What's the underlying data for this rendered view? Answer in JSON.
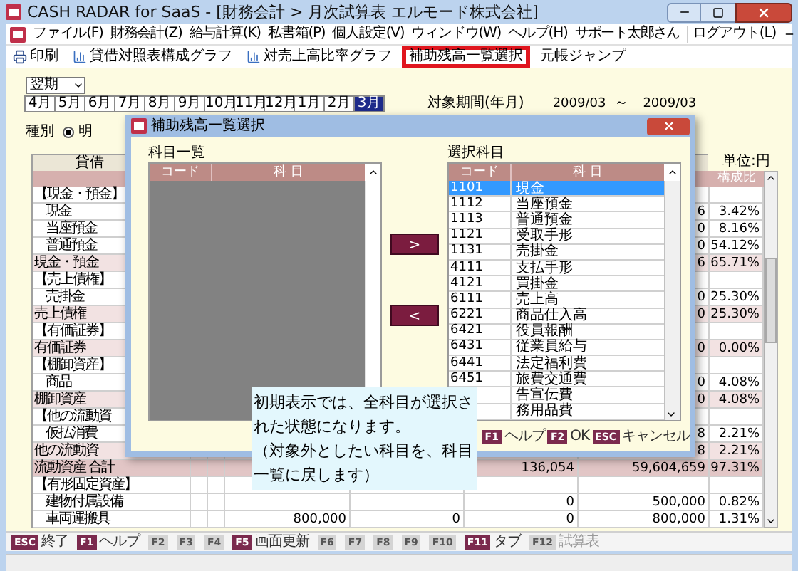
{
  "window": {
    "title": "CASH RADAR for SaaS - [財務会計 > 月次試算表 エルモード株式会社]"
  },
  "menu": {
    "items": [
      "ファイル(F)",
      "財務会計(Z)",
      "給与計算(K)",
      "私書箱(P)",
      "個人設定(V)",
      "ウィンドウ(W)",
      "ヘルプ(H)"
    ],
    "user": "サポート太郎さん",
    "logout": "ログアウト(L)"
  },
  "toolbar": [
    {
      "label": "印刷",
      "kind": "print",
      "highlighted": false
    },
    {
      "label": "貸借対照表構成グラフ",
      "kind": "chart",
      "highlighted": false
    },
    {
      "label": "対売上高比率グラフ",
      "kind": "chart",
      "highlighted": false
    },
    {
      "label": "補助残高一覧選択",
      "kind": "plain",
      "highlighted": true
    },
    {
      "label": "元帳ジャンプ",
      "kind": "plain",
      "highlighted": false
    }
  ],
  "period": {
    "select": "翌期",
    "months": [
      {
        "label": "4月",
        "selected": false
      },
      {
        "label": "5月",
        "selected": false
      },
      {
        "label": "6月",
        "selected": false
      },
      {
        "label": "7月",
        "selected": false
      },
      {
        "label": "8月",
        "selected": false
      },
      {
        "label": "9月",
        "selected": false
      },
      {
        "label": "10月",
        "selected": false
      },
      {
        "label": "11月",
        "selected": false
      },
      {
        "label": "12月",
        "selected": false
      },
      {
        "label": "1月",
        "selected": false
      },
      {
        "label": "2月",
        "selected": false
      },
      {
        "label": "3月",
        "selected": true
      }
    ],
    "range_label": "対象期間(年月)",
    "from": "2009/03",
    "separator": "～",
    "to": "2009/03"
  },
  "type_filter": {
    "label": "種別",
    "option": "明",
    "selected": true
  },
  "table": {
    "heading": "貸借",
    "unit": "単位:円",
    "ratio_header": "構成比",
    "rows": [
      {
        "kind": "heading",
        "label": "【現金・預金】"
      },
      {
        "kind": "item",
        "label": "現金",
        "column_6": "6",
        "ratio": "3.42%"
      },
      {
        "kind": "item",
        "label": "当座預金",
        "column_6": "0",
        "ratio": "8.16%"
      },
      {
        "kind": "item",
        "label": "普通預金",
        "column_6": "0",
        "ratio": "54.12%"
      },
      {
        "kind": "subtotal",
        "label": "現金・預金",
        "column_6": "6",
        "ratio": "65.71%"
      },
      {
        "kind": "heading",
        "label": "【売上債権】"
      },
      {
        "kind": "item",
        "label": "売掛金",
        "column_6": "0",
        "ratio": "25.30%"
      },
      {
        "kind": "subtotal",
        "label": "売上債権",
        "column_6": "0",
        "ratio": "25.30%"
      },
      {
        "kind": "heading",
        "label": "【有価証券】"
      },
      {
        "kind": "subtotal",
        "label": "有価証券",
        "column_6": "0",
        "ratio": "0.00%"
      },
      {
        "kind": "heading",
        "label": "【棚卸資産】"
      },
      {
        "kind": "item",
        "label": "商品",
        "column_6": "0",
        "ratio": "4.08%"
      },
      {
        "kind": "subtotal",
        "label": "棚卸資産",
        "column_6": "0",
        "ratio": "4.08%"
      },
      {
        "kind": "heading",
        "label": "【他の流動資"
      },
      {
        "kind": "item",
        "label": "仮払消費",
        "column_6": "8",
        "ratio": "2.21%"
      },
      {
        "kind": "subtotal",
        "label": "他の流動資",
        "column_6": "8",
        "ratio": "2.21%"
      },
      {
        "kind": "total",
        "label": "流動資産 合計",
        "column_5": "136,054",
        "column_6": "59,604,659",
        "ratio": "97.31%"
      },
      {
        "kind": "heading",
        "label": "【有形固定資産】"
      },
      {
        "kind": "item",
        "label": "建物付属設備",
        "column_5": "0",
        "column_6": "500,000",
        "ratio": "0.82%"
      },
      {
        "kind": "item",
        "label": "車両運搬具",
        "column_3": "800,000",
        "column_4": "0",
        "column_5": "0",
        "column_6": "800,000",
        "ratio": "1.31%"
      }
    ]
  },
  "dialog": {
    "title": "補助残高一覧選択",
    "available": {
      "title": "科目一覧",
      "code_header": "コード",
      "name_header": "科 目"
    },
    "add_label": ">",
    "remove_label": "<",
    "selected_list": {
      "title": "選択科目",
      "code_header": "コード",
      "name_header": "科 目",
      "rows": [
        {
          "code": "1101",
          "name": "現金",
          "selected": true
        },
        {
          "code": "1112",
          "name": "当座預金",
          "selected": false
        },
        {
          "code": "1113",
          "name": "普通預金",
          "selected": false
        },
        {
          "code": "1121",
          "name": "受取手形",
          "selected": false
        },
        {
          "code": "1131",
          "name": "売掛金",
          "selected": false
        },
        {
          "code": "4111",
          "name": "支払手形",
          "selected": false
        },
        {
          "code": "4121",
          "name": "買掛金",
          "selected": false
        },
        {
          "code": "6111",
          "name": "売上高",
          "selected": false
        },
        {
          "code": "6221",
          "name": "商品仕入高",
          "selected": false
        },
        {
          "code": "6421",
          "name": "役員報酬",
          "selected": false
        },
        {
          "code": "6431",
          "name": "従業員給与",
          "selected": false
        },
        {
          "code": "6441",
          "name": "法定福利費",
          "selected": false
        },
        {
          "code": "6451",
          "name": "旅費交通費",
          "selected": false
        },
        {
          "name": "告宣伝費",
          "selected": false
        },
        {
          "name": "務用品費",
          "selected": false
        }
      ]
    },
    "keys": [
      {
        "key": "F1",
        "label": "ヘルプ",
        "disabled": false
      },
      {
        "key": "F2",
        "label": "OK",
        "disabled": false
      },
      {
        "key": "ESC",
        "label": "キャンセル",
        "disabled": false
      }
    ]
  },
  "callout": [
    "初期表示では、全科目が選択された状態になります。",
    "（対象外としたい科目を、科目一覧に戻します）"
  ],
  "function_keys": [
    {
      "key": "ESC",
      "label": "終了",
      "disabled": false
    },
    {
      "key": "F1",
      "label": "ヘルプ",
      "disabled": false
    },
    {
      "key": "F2",
      "disabled": true
    },
    {
      "key": "F3",
      "disabled": true
    },
    {
      "key": "F4",
      "disabled": true
    },
    {
      "key": "F5",
      "label": "画面更新",
      "disabled": false
    },
    {
      "key": "F6",
      "disabled": true
    },
    {
      "key": "F7",
      "disabled": true
    },
    {
      "key": "F8",
      "disabled": true
    },
    {
      "key": "F9",
      "disabled": true
    },
    {
      "key": "F10",
      "disabled": true
    },
    {
      "key": "F11",
      "label": "タブ",
      "disabled": false
    },
    {
      "key": "F12",
      "label": "試算表",
      "disabled": true
    }
  ]
}
